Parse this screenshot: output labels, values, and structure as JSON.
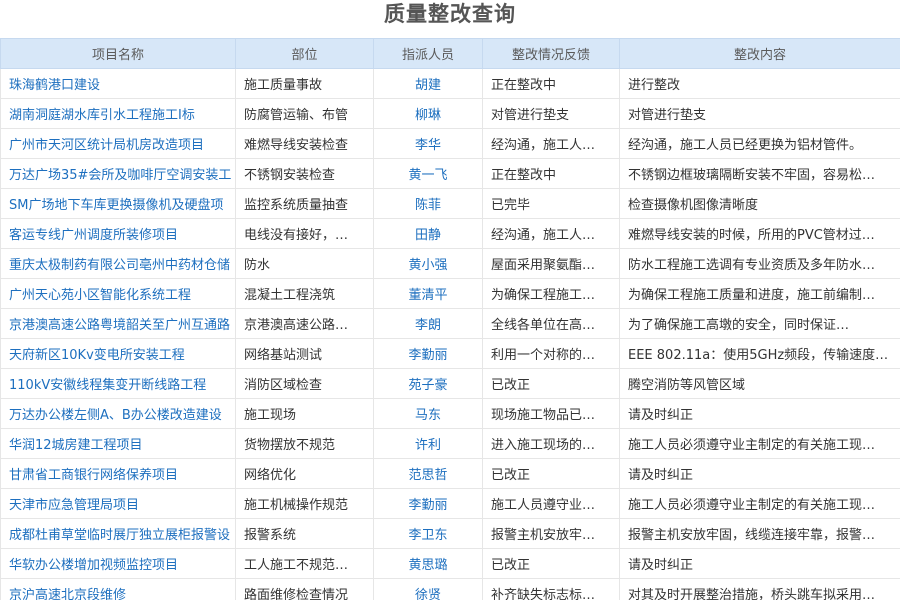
{
  "page": {
    "title": "质量整改查询"
  },
  "table": {
    "headers": [
      "项目名称",
      "部位",
      "指派人员",
      "整改情况反馈",
      "整改内容"
    ],
    "rows": [
      {
        "name": "珠海鹤港口建设",
        "part": "施工质量事故",
        "person": "胡建",
        "feedback": "正在整改中",
        "content": "进行整改"
      },
      {
        "name": "湖南洞庭湖水库引水工程施工I标",
        "part": "防腐管运输、布管",
        "person": "柳琳",
        "feedback": "对管进行垫支",
        "content": "对管进行垫支"
      },
      {
        "name": "广州市天河区统计局机房改造项目",
        "part": "难燃导线安装检查",
        "person": "李华",
        "feedback": "经沟通，施工人…",
        "content": "经沟通，施工人员已经更换为铝材管件。"
      },
      {
        "name": "万达广场35#会所及咖啡厅空调安装工",
        "part": "不锈钢安装检查",
        "person": "黄一飞",
        "feedback": "正在整改中",
        "content": "不锈钢边框玻璃隔断安装不牢固，容易松…"
      },
      {
        "name": "SM广场地下车库更换摄像机及硬盘项",
        "part": "监控系统质量抽查",
        "person": "陈菲",
        "feedback": "已完毕",
        "content": "检查摄像机图像清晰度"
      },
      {
        "name": "客运专线广州调度所装修项目",
        "part": "电线没有接好，…",
        "person": "田静",
        "feedback": "经沟通，施工人…",
        "content": "难燃导线安装的时候，所用的PVC管材过…"
      },
      {
        "name": "重庆太极制药有限公司亳州中药材仓储",
        "part": "防水",
        "person": "黄小强",
        "feedback": "屋面采用聚氨酯…",
        "content": "防水工程施工选调有专业资质及多年防水…"
      },
      {
        "name": "广州天心苑小区智能化系统工程",
        "part": "混凝土工程浇筑",
        "person": "董清平",
        "feedback": "为确保工程施工…",
        "content": "为确保工程施工质量和进度，施工前编制…"
      },
      {
        "name": "京港澳高速公路粤境韶关至广州互通路",
        "part": "京港澳高速公路…",
        "person": "李朗",
        "feedback": "全线各单位在高…",
        "content": "为了确保施工高墩的安全，同时保证…"
      },
      {
        "name": "天府新区10Kv变电所安装工程",
        "part": "网络基站测试",
        "person": "李勤丽",
        "feedback": "利用一个对称的…",
        "content": "EEE 802.11a：使用5GHz频段，传输速度…"
      },
      {
        "name": "110kV安徽线程集变开断线路工程",
        "part": "消防区域检查",
        "person": "苑子豪",
        "feedback": "已改正",
        "content": "腾空消防等风管区域"
      },
      {
        "name": "万达办公楼左侧A、B办公楼改造建设",
        "part": "施工现场",
        "person": "马东",
        "feedback": "现场施工物品已…",
        "content": "请及时纠正"
      },
      {
        "name": "华润12城房建工程项目",
        "part": "货物摆放不规范",
        "person": "许利",
        "feedback": "进入施工现场的…",
        "content": "施工人员必须遵守业主制定的有关施工现…"
      },
      {
        "name": "甘肃省工商银行网络保养项目",
        "part": "网络优化",
        "person": "范思哲",
        "feedback": "已改正",
        "content": "请及时纠正"
      },
      {
        "name": "天津市应急管理局项目",
        "part": "施工机械操作规范",
        "person": "李勤丽",
        "feedback": "施工人员遵守业…",
        "content": "施工人员必须遵守业主制定的有关施工现…"
      },
      {
        "name": "成都杜甫草堂临时展厅独立展柜报警设",
        "part": "报警系统",
        "person": "李卫东",
        "feedback": "报警主机安放牢…",
        "content": "报警主机安放牢固，线缆连接牢靠，报警…"
      },
      {
        "name": "华软办公楼增加视频监控项目",
        "part": "工人施工不规范…",
        "person": "黄思璐",
        "feedback": "已改正",
        "content": "请及时纠正"
      },
      {
        "name": "京沪高速北京段维修",
        "part": "路面维修检查情况",
        "person": "徐贤",
        "feedback": "补齐缺失标志标…",
        "content": "对其及时开展整治措施，桥头跳车拟采用…"
      }
    ]
  }
}
